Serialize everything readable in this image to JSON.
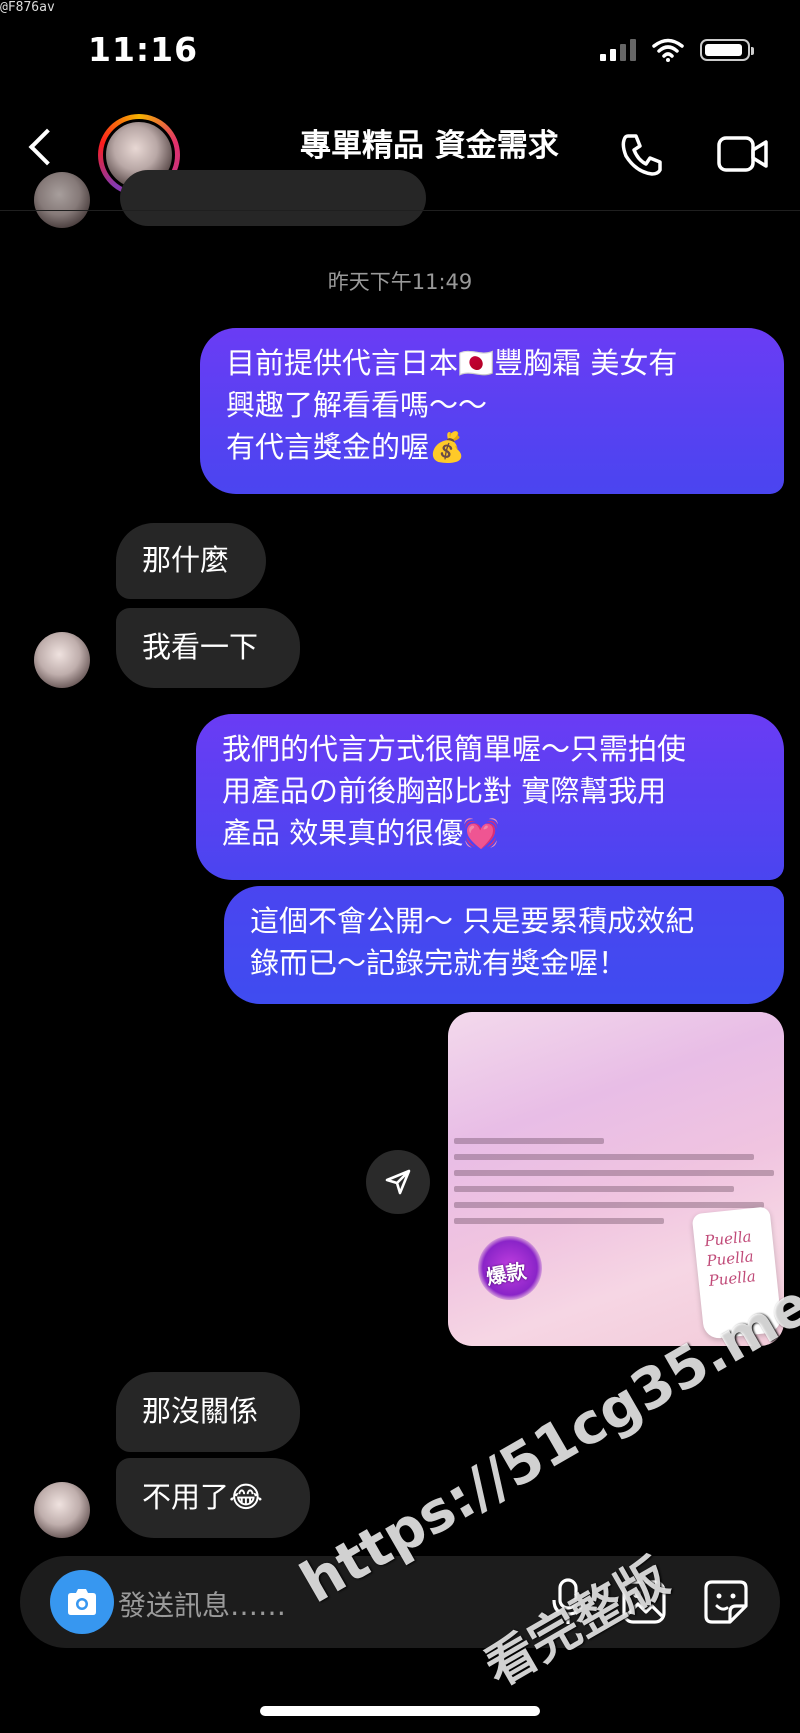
{
  "watermark_top": "@F876av",
  "status_bar": {
    "time": "11:16"
  },
  "header": {
    "title": "專單精品 資金需求"
  },
  "thread": {
    "timestamp": "昨天下午11:49",
    "msg1": {
      "lines": [
        "目前提供代言日本🇯🇵豐胸霜  美女有",
        "興趣了解看看嗎～～",
        "有代言獎金的喔💰"
      ]
    },
    "msg2": "那什麼",
    "msg3": "我看一下",
    "msg4": {
      "lines": [
        "我們的代言方式很簡單喔～只需拍使",
        "用產品の前後胸部比對  實際幫我用",
        "產品  效果真的很優💓"
      ]
    },
    "msg5": {
      "lines": [
        "這個不會公開～  只是要累積成效紀",
        "錄而已～記錄完就有獎金喔！"
      ]
    },
    "image": {
      "product_text": [
        "Puella",
        "Puella",
        "Puella"
      ],
      "badge": "爆款"
    },
    "msg6": "那沒關係",
    "msg7": "不用了😂"
  },
  "composer": {
    "placeholder": "發送訊息……"
  },
  "watermark": {
    "line1": "https://51cg35.me",
    "line2": "看完整版"
  },
  "colors": {
    "outgoing_bubble": "#5a40f2",
    "incoming_bubble": "#262626",
    "camera_button": "#3797f0"
  }
}
